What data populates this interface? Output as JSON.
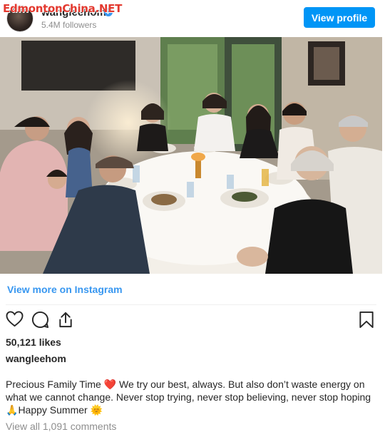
{
  "watermark": {
    "text": "EdmontonChina.NET"
  },
  "header": {
    "username": "wangleehom",
    "followers": "5.4M followers",
    "view_profile_label": "View profile",
    "avatar_icon": "avatar",
    "verified_icon": "verified-badge-icon"
  },
  "post": {
    "view_more_label": "View more on Instagram",
    "likes": "50,121 likes",
    "caption_user": "wangleehom",
    "caption_part1": "Precious Family Time",
    "caption_emoji_heart": "❤️",
    "caption_part2": "We try our best, always. But also don’t waste energy on what we cannot change. Never stop trying, never stop believing, never stop hoping",
    "caption_emoji_pray": "🙏",
    "caption_part3": "Happy Summer",
    "caption_emoji_sun": "🌞",
    "comments_label": "View all 1,091 comments"
  },
  "actions": [
    "heart-icon",
    "comment-icon",
    "share-icon",
    "bookmark-icon"
  ],
  "colors": {
    "accent": "#0095f6",
    "link": "#3897f0",
    "muted": "#8e8e8e",
    "text": "#262626"
  }
}
